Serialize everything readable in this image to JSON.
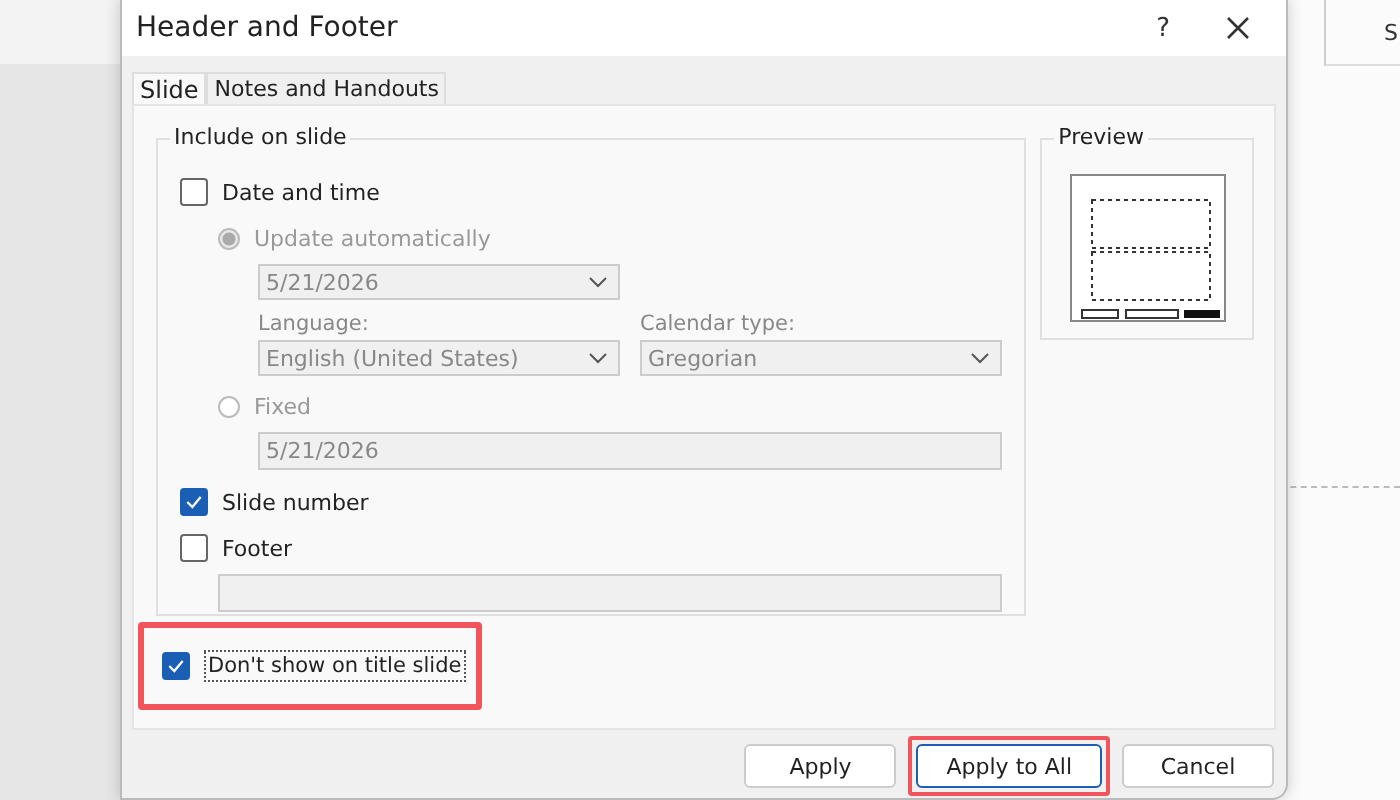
{
  "app": {
    "ribbon_text": "S"
  },
  "dialog": {
    "title": "Header and Footer",
    "help": "?",
    "tabs": [
      {
        "label": "Slide",
        "selected": true
      },
      {
        "label": "Notes and Handouts",
        "selected": false
      }
    ],
    "include": {
      "legend": "Include on slide",
      "date_time": {
        "label": "Date and time",
        "checked": false
      },
      "update_auto": {
        "label": "Update automatically",
        "selected": true,
        "disabled": true
      },
      "date_value": "5/21/2026",
      "language": {
        "label": "Language:",
        "value": "English (United States)"
      },
      "calendar": {
        "label": "Calendar type:",
        "value": "Gregorian"
      },
      "fixed": {
        "label": "Fixed",
        "selected": false,
        "disabled": true
      },
      "fixed_value": "5/21/2026",
      "slide_number": {
        "label": "Slide number",
        "checked": true
      },
      "footer": {
        "label": "Footer",
        "checked": false
      }
    },
    "title_slide": {
      "label": "Don't show on title slide",
      "checked": true,
      "highlighted": true
    },
    "preview": {
      "legend": "Preview"
    },
    "buttons": [
      {
        "label": "Apply",
        "highlighted": false
      },
      {
        "label": "Apply to All",
        "highlighted": true
      },
      {
        "label": "Cancel",
        "highlighted": false
      }
    ]
  }
}
